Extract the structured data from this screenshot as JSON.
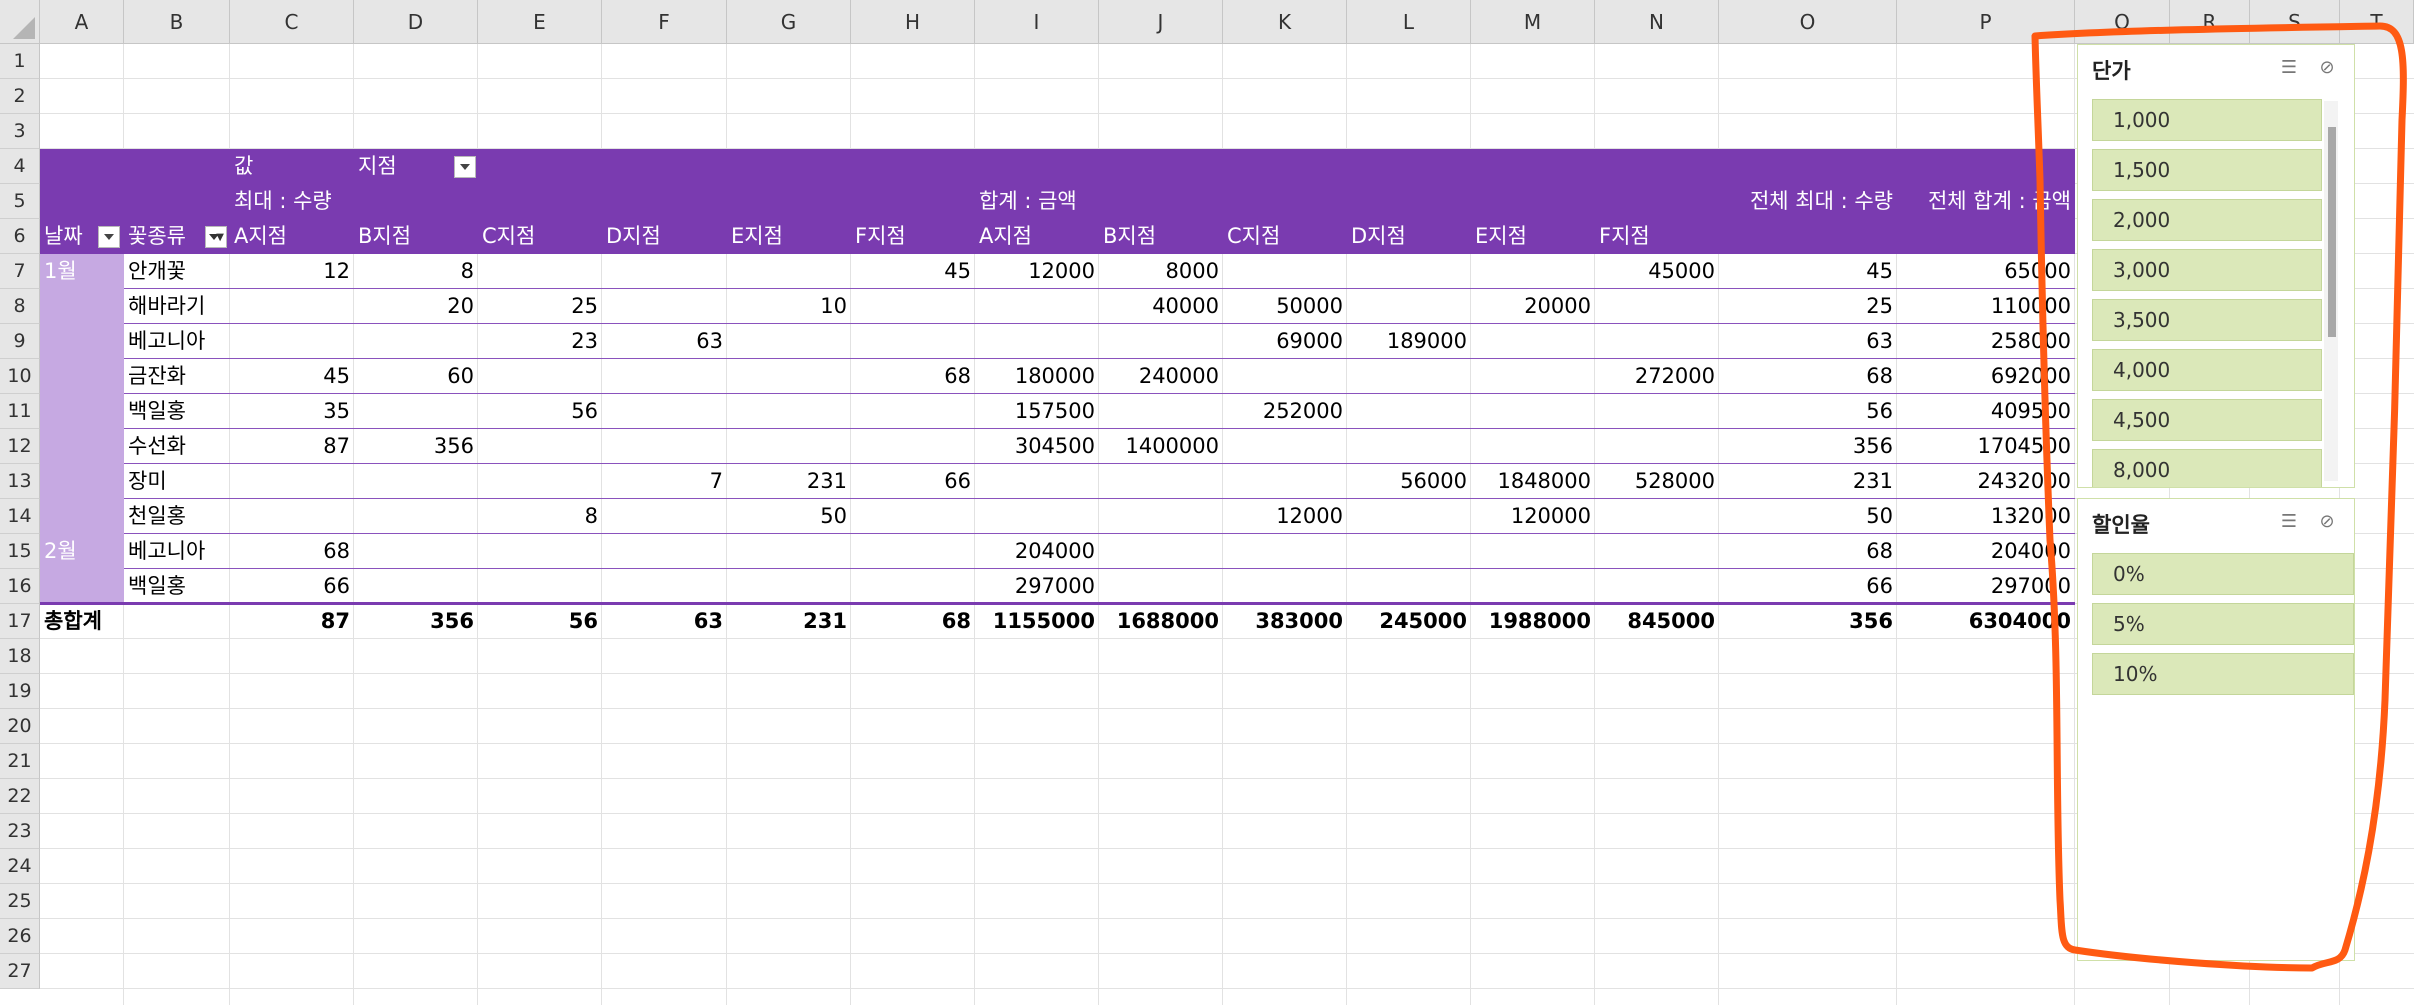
{
  "columns": [
    "A",
    "B",
    "C",
    "D",
    "E",
    "F",
    "G",
    "H",
    "I",
    "J",
    "K",
    "L",
    "M",
    "N",
    "O",
    "P",
    "Q",
    "R",
    "S",
    "T"
  ],
  "rows": [
    "1",
    "2",
    "3",
    "4",
    "5",
    "6",
    "7",
    "8",
    "9",
    "10",
    "11",
    "12",
    "13",
    "14",
    "15",
    "16",
    "17",
    "18",
    "19",
    "20",
    "21",
    "22",
    "23",
    "24",
    "25",
    "26",
    "27"
  ],
  "pivot": {
    "values_label": "값",
    "branch_field": "지점",
    "max_qty_label": "최대 : 수량",
    "sum_amt_label": "합계 : 금액",
    "grand_max_label": "전체 최대 : 수량",
    "grand_sum_label": "전체 합계 : 금액",
    "date_field": "날짜",
    "flower_field": "꽃종류",
    "branches_qty": [
      "A지점",
      "B지점",
      "C지점",
      "D지점",
      "E지점",
      "F지점"
    ],
    "branches_amt": [
      "A지점",
      "B지점",
      "C지점",
      "D지점",
      "E지점",
      "F지점"
    ],
    "data_rows": [
      {
        "month": "1월",
        "flower": "안개꽃",
        "qty": [
          "12",
          "8",
          "",
          "",
          "",
          "45"
        ],
        "amt": [
          "12000",
          "8000",
          "",
          "",
          "",
          "45000"
        ],
        "max": "45",
        "sum": "65000"
      },
      {
        "month": "",
        "flower": "해바라기",
        "qty": [
          "",
          "20",
          "25",
          "",
          "10",
          ""
        ],
        "amt": [
          "",
          "40000",
          "50000",
          "",
          "20000",
          ""
        ],
        "max": "25",
        "sum": "110000"
      },
      {
        "month": "",
        "flower": "베고니아",
        "qty": [
          "",
          "",
          "23",
          "63",
          "",
          ""
        ],
        "amt": [
          "",
          "",
          "69000",
          "189000",
          "",
          ""
        ],
        "max": "63",
        "sum": "258000"
      },
      {
        "month": "",
        "flower": "금잔화",
        "qty": [
          "45",
          "60",
          "",
          "",
          "",
          "68"
        ],
        "amt": [
          "180000",
          "240000",
          "",
          "",
          "",
          "272000"
        ],
        "max": "68",
        "sum": "692000"
      },
      {
        "month": "",
        "flower": "백일홍",
        "qty": [
          "35",
          "",
          "56",
          "",
          "",
          ""
        ],
        "amt": [
          "157500",
          "",
          "252000",
          "",
          "",
          ""
        ],
        "max": "56",
        "sum": "409500"
      },
      {
        "month": "",
        "flower": "수선화",
        "qty": [
          "87",
          "356",
          "",
          "",
          "",
          ""
        ],
        "amt": [
          "304500",
          "1400000",
          "",
          "",
          "",
          ""
        ],
        "max": "356",
        "sum": "1704500"
      },
      {
        "month": "",
        "flower": "장미",
        "qty": [
          "",
          "",
          "",
          "7",
          "231",
          "66"
        ],
        "amt": [
          "",
          "",
          "",
          "56000",
          "1848000",
          "528000"
        ],
        "max": "231",
        "sum": "2432000"
      },
      {
        "month": "",
        "flower": "천일홍",
        "qty": [
          "",
          "",
          "8",
          "",
          "50",
          ""
        ],
        "amt": [
          "",
          "",
          "12000",
          "",
          "120000",
          ""
        ],
        "max": "50",
        "sum": "132000"
      },
      {
        "month": "2월",
        "flower": "베고니아",
        "qty": [
          "68",
          "",
          "",
          "",
          "",
          ""
        ],
        "amt": [
          "204000",
          "",
          "",
          "",
          "",
          ""
        ],
        "max": "68",
        "sum": "204000"
      },
      {
        "month": "",
        "flower": "백일홍",
        "qty": [
          "66",
          "",
          "",
          "",
          "",
          ""
        ],
        "amt": [
          "297000",
          "",
          "",
          "",
          "",
          ""
        ],
        "max": "66",
        "sum": "297000"
      }
    ],
    "total_label": "총합계",
    "total_qty": [
      "87",
      "356",
      "56",
      "63",
      "231",
      "68"
    ],
    "total_amt": [
      "1155000",
      "1688000",
      "383000",
      "245000",
      "1988000",
      "845000"
    ],
    "total_max": "356",
    "total_sum": "6304000"
  },
  "slicer_price": {
    "title": "단가",
    "items": [
      "1,000",
      "1,500",
      "2,000",
      "3,000",
      "3,500",
      "4,000",
      "4,500",
      "8,000"
    ],
    "multiselect_icon": "multi-select-icon",
    "clear_icon": "clear-filter-icon"
  },
  "slicer_discount": {
    "title": "할인율",
    "items": [
      "0%",
      "5%",
      "10%"
    ],
    "multiselect_icon": "multi-select-icon",
    "clear_icon": "clear-filter-icon"
  },
  "colors": {
    "pivot_header": "#7a3bb0",
    "pivot_rowlabel": "#c6a9e2",
    "slicer_item": "#dbe8b9",
    "annotation": "#ff5a12"
  }
}
